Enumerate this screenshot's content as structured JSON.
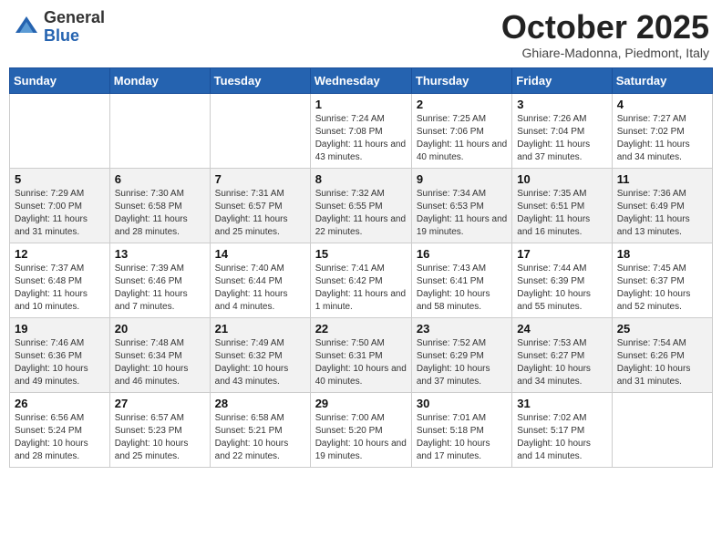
{
  "header": {
    "logo_general": "General",
    "logo_blue": "Blue",
    "month_title": "October 2025",
    "subtitle": "Ghiare-Madonna, Piedmont, Italy"
  },
  "weekdays": [
    "Sunday",
    "Monday",
    "Tuesday",
    "Wednesday",
    "Thursday",
    "Friday",
    "Saturday"
  ],
  "weeks": [
    [
      {
        "day": "",
        "info": ""
      },
      {
        "day": "",
        "info": ""
      },
      {
        "day": "",
        "info": ""
      },
      {
        "day": "1",
        "info": "Sunrise: 7:24 AM\nSunset: 7:08 PM\nDaylight: 11 hours and 43 minutes."
      },
      {
        "day": "2",
        "info": "Sunrise: 7:25 AM\nSunset: 7:06 PM\nDaylight: 11 hours and 40 minutes."
      },
      {
        "day": "3",
        "info": "Sunrise: 7:26 AM\nSunset: 7:04 PM\nDaylight: 11 hours and 37 minutes."
      },
      {
        "day": "4",
        "info": "Sunrise: 7:27 AM\nSunset: 7:02 PM\nDaylight: 11 hours and 34 minutes."
      }
    ],
    [
      {
        "day": "5",
        "info": "Sunrise: 7:29 AM\nSunset: 7:00 PM\nDaylight: 11 hours and 31 minutes."
      },
      {
        "day": "6",
        "info": "Sunrise: 7:30 AM\nSunset: 6:58 PM\nDaylight: 11 hours and 28 minutes."
      },
      {
        "day": "7",
        "info": "Sunrise: 7:31 AM\nSunset: 6:57 PM\nDaylight: 11 hours and 25 minutes."
      },
      {
        "day": "8",
        "info": "Sunrise: 7:32 AM\nSunset: 6:55 PM\nDaylight: 11 hours and 22 minutes."
      },
      {
        "day": "9",
        "info": "Sunrise: 7:34 AM\nSunset: 6:53 PM\nDaylight: 11 hours and 19 minutes."
      },
      {
        "day": "10",
        "info": "Sunrise: 7:35 AM\nSunset: 6:51 PM\nDaylight: 11 hours and 16 minutes."
      },
      {
        "day": "11",
        "info": "Sunrise: 7:36 AM\nSunset: 6:49 PM\nDaylight: 11 hours and 13 minutes."
      }
    ],
    [
      {
        "day": "12",
        "info": "Sunrise: 7:37 AM\nSunset: 6:48 PM\nDaylight: 11 hours and 10 minutes."
      },
      {
        "day": "13",
        "info": "Sunrise: 7:39 AM\nSunset: 6:46 PM\nDaylight: 11 hours and 7 minutes."
      },
      {
        "day": "14",
        "info": "Sunrise: 7:40 AM\nSunset: 6:44 PM\nDaylight: 11 hours and 4 minutes."
      },
      {
        "day": "15",
        "info": "Sunrise: 7:41 AM\nSunset: 6:42 PM\nDaylight: 11 hours and 1 minute."
      },
      {
        "day": "16",
        "info": "Sunrise: 7:43 AM\nSunset: 6:41 PM\nDaylight: 10 hours and 58 minutes."
      },
      {
        "day": "17",
        "info": "Sunrise: 7:44 AM\nSunset: 6:39 PM\nDaylight: 10 hours and 55 minutes."
      },
      {
        "day": "18",
        "info": "Sunrise: 7:45 AM\nSunset: 6:37 PM\nDaylight: 10 hours and 52 minutes."
      }
    ],
    [
      {
        "day": "19",
        "info": "Sunrise: 7:46 AM\nSunset: 6:36 PM\nDaylight: 10 hours and 49 minutes."
      },
      {
        "day": "20",
        "info": "Sunrise: 7:48 AM\nSunset: 6:34 PM\nDaylight: 10 hours and 46 minutes."
      },
      {
        "day": "21",
        "info": "Sunrise: 7:49 AM\nSunset: 6:32 PM\nDaylight: 10 hours and 43 minutes."
      },
      {
        "day": "22",
        "info": "Sunrise: 7:50 AM\nSunset: 6:31 PM\nDaylight: 10 hours and 40 minutes."
      },
      {
        "day": "23",
        "info": "Sunrise: 7:52 AM\nSunset: 6:29 PM\nDaylight: 10 hours and 37 minutes."
      },
      {
        "day": "24",
        "info": "Sunrise: 7:53 AM\nSunset: 6:27 PM\nDaylight: 10 hours and 34 minutes."
      },
      {
        "day": "25",
        "info": "Sunrise: 7:54 AM\nSunset: 6:26 PM\nDaylight: 10 hours and 31 minutes."
      }
    ],
    [
      {
        "day": "26",
        "info": "Sunrise: 6:56 AM\nSunset: 5:24 PM\nDaylight: 10 hours and 28 minutes."
      },
      {
        "day": "27",
        "info": "Sunrise: 6:57 AM\nSunset: 5:23 PM\nDaylight: 10 hours and 25 minutes."
      },
      {
        "day": "28",
        "info": "Sunrise: 6:58 AM\nSunset: 5:21 PM\nDaylight: 10 hours and 22 minutes."
      },
      {
        "day": "29",
        "info": "Sunrise: 7:00 AM\nSunset: 5:20 PM\nDaylight: 10 hours and 19 minutes."
      },
      {
        "day": "30",
        "info": "Sunrise: 7:01 AM\nSunset: 5:18 PM\nDaylight: 10 hours and 17 minutes."
      },
      {
        "day": "31",
        "info": "Sunrise: 7:02 AM\nSunset: 5:17 PM\nDaylight: 10 hours and 14 minutes."
      },
      {
        "day": "",
        "info": ""
      }
    ]
  ]
}
